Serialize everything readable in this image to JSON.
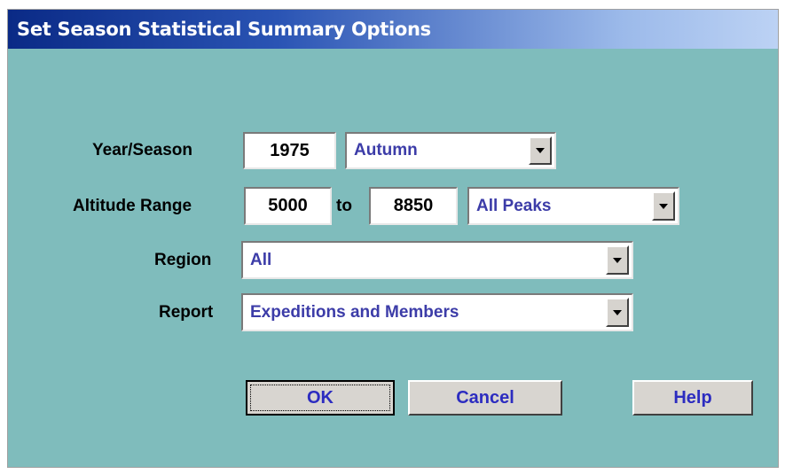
{
  "window": {
    "title": "Set Season Statistical Summary Options"
  },
  "form": {
    "year_season": {
      "label": "Year/Season",
      "year": "1975",
      "season": "Autumn"
    },
    "altitude": {
      "label": "Altitude Range",
      "from": "5000",
      "to_label": "to",
      "to": "8850",
      "peaks": "All Peaks"
    },
    "region": {
      "label": "Region",
      "value": "All"
    },
    "report": {
      "label": "Report",
      "value": "Expeditions and Members"
    }
  },
  "buttons": {
    "ok": "OK",
    "cancel": "Cancel",
    "help": "Help"
  },
  "colors": {
    "dialog_bg": "#7fbcbc",
    "title_start": "#0a2a86",
    "title_end": "#bcd2f4",
    "value_text": "#3c3ca8",
    "button_text": "#2c2cc0"
  },
  "icons": {
    "dropdown": "chevron-down-icon"
  }
}
